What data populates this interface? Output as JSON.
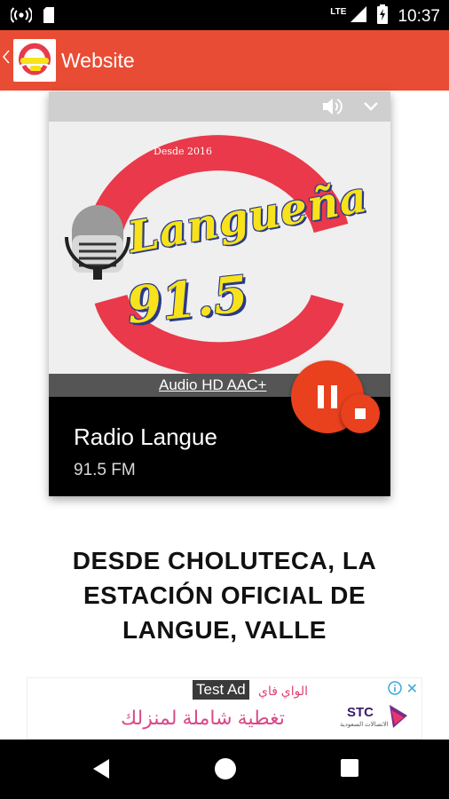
{
  "status_bar": {
    "network_label": "LTE",
    "time": "10:37"
  },
  "app_bar": {
    "title": "Website"
  },
  "player": {
    "logo": {
      "since_text": "Desde 2016",
      "brand_text": "Langueña",
      "frequency_text": "91.5"
    },
    "quality_label": "Audio HD AAC+",
    "station_name": "Radio Langue",
    "station_frequency": "91.5 FM"
  },
  "description": {
    "lines": [
      "DESDE CHOLUTECA, LA",
      "ESTACIÓN OFICIAL DE",
      "LANGUE, VALLE"
    ]
  },
  "ad": {
    "tag": "Test Ad",
    "line1": "الواي فاي",
    "line2": "تغطية شاملة لمنزلك",
    "brand": "STC",
    "brand_sub": "الاتصالات السعودية"
  },
  "colors": {
    "app_bar": "#e94c34",
    "accent": "#e9401d",
    "logo_red": "#e9394a",
    "logo_yellow": "#f7e21b"
  }
}
